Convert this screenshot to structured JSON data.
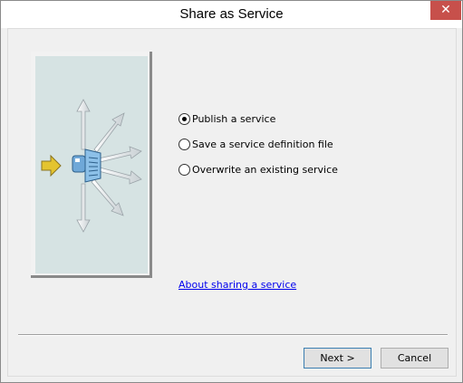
{
  "window": {
    "title": "Share as Service",
    "close_glyph": "✕"
  },
  "options": [
    {
      "label": "Publish a service",
      "checked": true
    },
    {
      "label": "Save a service definition file",
      "checked": false
    },
    {
      "label": "Overwrite an existing service",
      "checked": false
    }
  ],
  "help_link": "About sharing a service",
  "buttons": {
    "next": "Next >",
    "cancel": "Cancel"
  },
  "illustration": {
    "icon": "service-publish-icon"
  },
  "colors": {
    "panel_bg": "#d6e3e3",
    "arrow_yellow": "#e4c42f",
    "link": "#0000ee"
  }
}
